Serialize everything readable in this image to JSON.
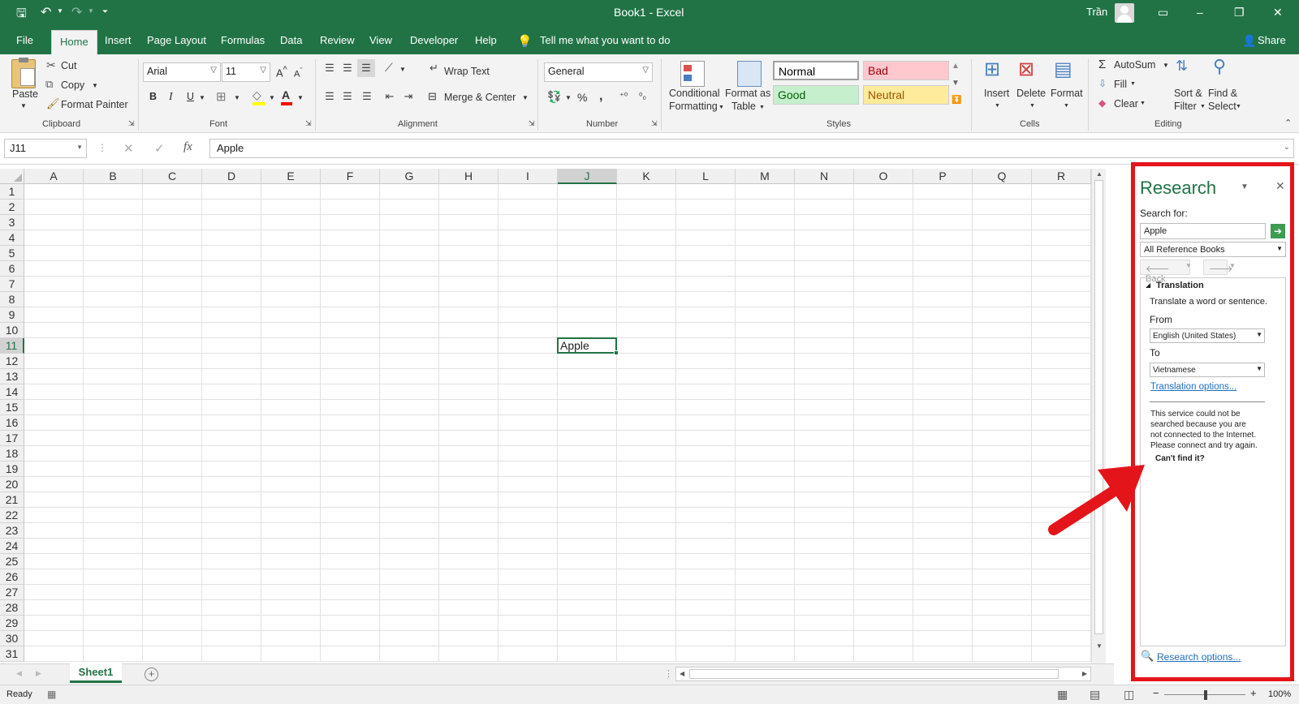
{
  "app": {
    "title": "Book1  -  Excel",
    "user": "Trần"
  },
  "quick_access": {
    "save_icon": "save-icon",
    "undo_icon": "undo-icon",
    "redo_icon": "redo-icon",
    "customize_icon": "chevron-down-icon"
  },
  "window_controls": {
    "minimize": "–",
    "restore": "❐",
    "close": "✕",
    "ribbon_display": "▭"
  },
  "ribbon_tabs": [
    "File",
    "Home",
    "Insert",
    "Page Layout",
    "Formulas",
    "Data",
    "Review",
    "View",
    "Developer",
    "Help"
  ],
  "tell_me": "Tell me what you want to do",
  "share": "Share",
  "clipboard": {
    "paste": "Paste",
    "cut": "Cut",
    "copy": "Copy",
    "format_painter": "Format Painter",
    "group": "Clipboard"
  },
  "font": {
    "name": "Arial",
    "size": "11",
    "bold": "B",
    "italic": "I",
    "underline": "U",
    "group": "Font",
    "grow": "A",
    "shrink": "A"
  },
  "alignment": {
    "wrap": "Wrap Text",
    "merge": "Merge & Center",
    "group": "Alignment"
  },
  "number": {
    "format": "General",
    "percent": "%",
    "comma": ",",
    "group": "Number"
  },
  "styles": {
    "conditional_1": "Conditional",
    "conditional_2": "Formatting",
    "format_table_1": "Format as",
    "format_table_2": "Table",
    "normal": "Normal",
    "bad": "Bad",
    "good": "Good",
    "neutral": "Neutral",
    "group": "Styles"
  },
  "cells": {
    "insert": "Insert",
    "delete": "Delete",
    "format": "Format",
    "group": "Cells"
  },
  "editing": {
    "autosum": "AutoSum",
    "fill": "Fill",
    "clear": "Clear",
    "sort_1": "Sort &",
    "sort_2": "Filter",
    "find_1": "Find &",
    "find_2": "Select",
    "group": "Editing"
  },
  "formula_bar": {
    "name_box": "J11",
    "cancel": "✕",
    "enter": "✓",
    "fx": "fx",
    "content": "Apple"
  },
  "grid": {
    "columns": [
      "A",
      "B",
      "C",
      "D",
      "E",
      "F",
      "G",
      "H",
      "I",
      "J",
      "K",
      "L",
      "M",
      "N",
      "O",
      "P",
      "Q",
      "R"
    ],
    "rows": [
      "1",
      "2",
      "3",
      "4",
      "5",
      "6",
      "7",
      "8",
      "9",
      "10",
      "11",
      "12",
      "13",
      "14",
      "15",
      "16",
      "17",
      "18",
      "19",
      "20",
      "21",
      "22",
      "23",
      "24",
      "25",
      "26",
      "27",
      "28",
      "29",
      "30",
      "31"
    ],
    "active_col": "J",
    "active_row": "11",
    "active_cell_value": "Apple"
  },
  "sheet": {
    "tab": "Sheet1",
    "add": "+"
  },
  "status": {
    "ready": "Ready",
    "zoom": "100%",
    "zoom_minus": "−",
    "zoom_plus": "+"
  },
  "research": {
    "title": "Research",
    "search_label": "Search for:",
    "search_value": "Apple",
    "source": "All Reference Books",
    "back": "Back",
    "section": "Translation",
    "section_desc": "Translate a word or sentence.",
    "from_label": "From",
    "from_value": "English (United States)",
    "to_label": "To",
    "to_value": "Vietnamese",
    "translation_options": "Translation options...",
    "message_1": "This service could not be",
    "message_2": "searched because you are",
    "message_3": "not connected to the Internet.",
    "message_4": "Please connect and try again.",
    "cant_find": "Can't find it?",
    "research_options": "Research options..."
  },
  "colors": {
    "excel_green": "#217346",
    "highlight_red": "#e4141b",
    "bad_bg": "#ffc7ce",
    "good_bg": "#c6efce",
    "neutral_bg": "#ffeb9c"
  }
}
